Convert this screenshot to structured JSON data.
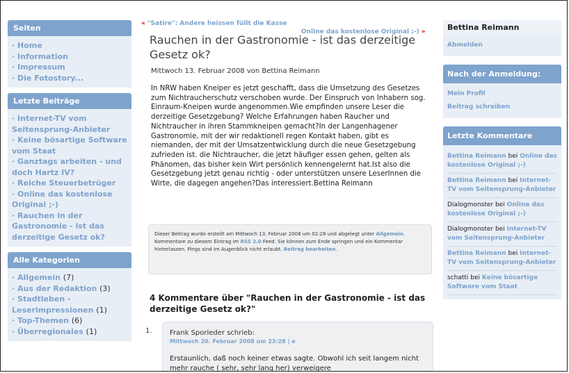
{
  "left_sidebar": {
    "pages": {
      "heading": "Seiten",
      "items": [
        "Home",
        "Information",
        "Impressum",
        "Die Fotostory..."
      ]
    },
    "recent_posts": {
      "heading": "Letzte Beiträge",
      "items": [
        "Internet-TV vom Seitensprung-Anbieter",
        "Keine bösartige Software vom Staat",
        "Ganztags arbeiten - und doch Hartz IV?",
        "Reiche Steuerbetrüger",
        "Online das kostenlose Original ;-)",
        "Rauchen in der Gastronomie - ist das derzeitige Gesetz ok?"
      ]
    },
    "categories": {
      "heading": "Alle Kategorien",
      "items": [
        {
          "label": "Allgemein",
          "count": "(7)"
        },
        {
          "label": "Aus der Redaktion",
          "count": "(3)"
        },
        {
          "label": "Stadtleben - Leserimpressionen",
          "count": "(1)"
        },
        {
          "label": "Top-Themen",
          "count": "(6)"
        },
        {
          "label": "Überregionales",
          "count": "(1)"
        }
      ]
    }
  },
  "post_nav": {
    "prev": "\"Satire\": Andere heissen füllt die Kasse",
    "next": "Online das kostenlose Original ;-)"
  },
  "post": {
    "title": "Rauchen in der Gastronomie - ist das derzeitige Gesetz ok?",
    "date_line": "Mittwoch 13. Februar 2008 von Bettina Reimann",
    "body": "In NRW haben Kneiper es jetzt geschafft, dass die Umsetzung des Gesetzes zum Nichtraucherschutz verschoben wurde. Der Einspruch von Inhabern sog. Einraum-Kneipen wurde angenommen.Wie empfinden unsere Leser die derzeitige Gesetzgebung? Welche Erfahrungen haben Raucher und Nichtraucher in ihren Stammkneipen gemacht?In der Langenhagener Gastronomie, mit der wir redaktionell regen Kontakt haben, gibt es niemanden, der mit der Umsatzentwicklung durch die neue Gesetzgebung zufrieden ist. die Nichtraucher, die jetzt häufiger essen gehen, gelten als Phänomen, das bisher kein Wirt persönlich kennengelernt hat.Ist also die Gesetzgebung jetzt genau richtig - oder unterstützen unsere LeserInnen die Wirte, die dagegen angehen?Das interessiert.Bettina Reimann",
    "meta_1": "Dieser Beitrag wurde erstellt am Mittwoch 13. Februar 2008 um 02:28 und abgelegt unter ",
    "meta_category": "Allgemein",
    "meta_2": ". Kommentare zu diesem Eintrag im ",
    "meta_feed": "RSS 2.0",
    "meta_3": " Feed. Sie können zum Ende springen und ein Kommentar hinterlassen. Pings sind im Augenblick nicht erlaubt. ",
    "meta_edit": "Beitrag bearbeiten",
    "meta_end": "."
  },
  "comments": {
    "heading": "4 Kommentare über \"Rauchen in der Gastronomie - ist das derzeitige Gesetz ok?\"",
    "items": [
      {
        "number": "1.",
        "author": "Frank Sporleder schrieb:",
        "date": "Mittwoch 20. Februar 2008 um 23:28 | e",
        "text": "Erstaunlich, daß noch keiner etwas sagte. Obwohl ich seit langem nicht mehr rauche ( sehr, sehr lang her) verweigere"
      }
    ]
  },
  "right_sidebar": {
    "user": {
      "name": "Bettina Reimann",
      "logout": "Abmelden"
    },
    "after_login": {
      "heading": "Nach der Anmeldung:",
      "links": [
        "Mein Profil",
        "Beitrag schreiben"
      ]
    },
    "recent_comments": {
      "heading": "Letzte Kommentare",
      "items": [
        {
          "who": "Bettina Reimann",
          "bei": " bei ",
          "what": "Online das kostenlose Original ;-)",
          "who_linked": true
        },
        {
          "who": "Bettina Reimann",
          "bei": " bei ",
          "what": "Internet-TV vom Seitensprung-Anbieter",
          "who_linked": true
        },
        {
          "who": "Dialogmonster",
          "bei": " bei ",
          "what": "Online das kostenlose Original ;-)",
          "who_linked": false
        },
        {
          "who": "Dialogmonster",
          "bei": " bei ",
          "what": "Internet-TV vom Seitensprung-Anbieter",
          "who_linked": false
        },
        {
          "who": "Bettina Reimann",
          "bei": " bei ",
          "what": "Internet-TV vom Seitensprung-Anbieter",
          "who_linked": true
        },
        {
          "who": "schatti",
          "bei": " bei ",
          "what": "Keine bösartige Software vom Staat",
          "who_linked": false
        }
      ]
    }
  },
  "colors": {
    "accent": "#7ea3cd",
    "sidebar_bg": "#e8eef5",
    "bullet_red": "#cc0000"
  }
}
